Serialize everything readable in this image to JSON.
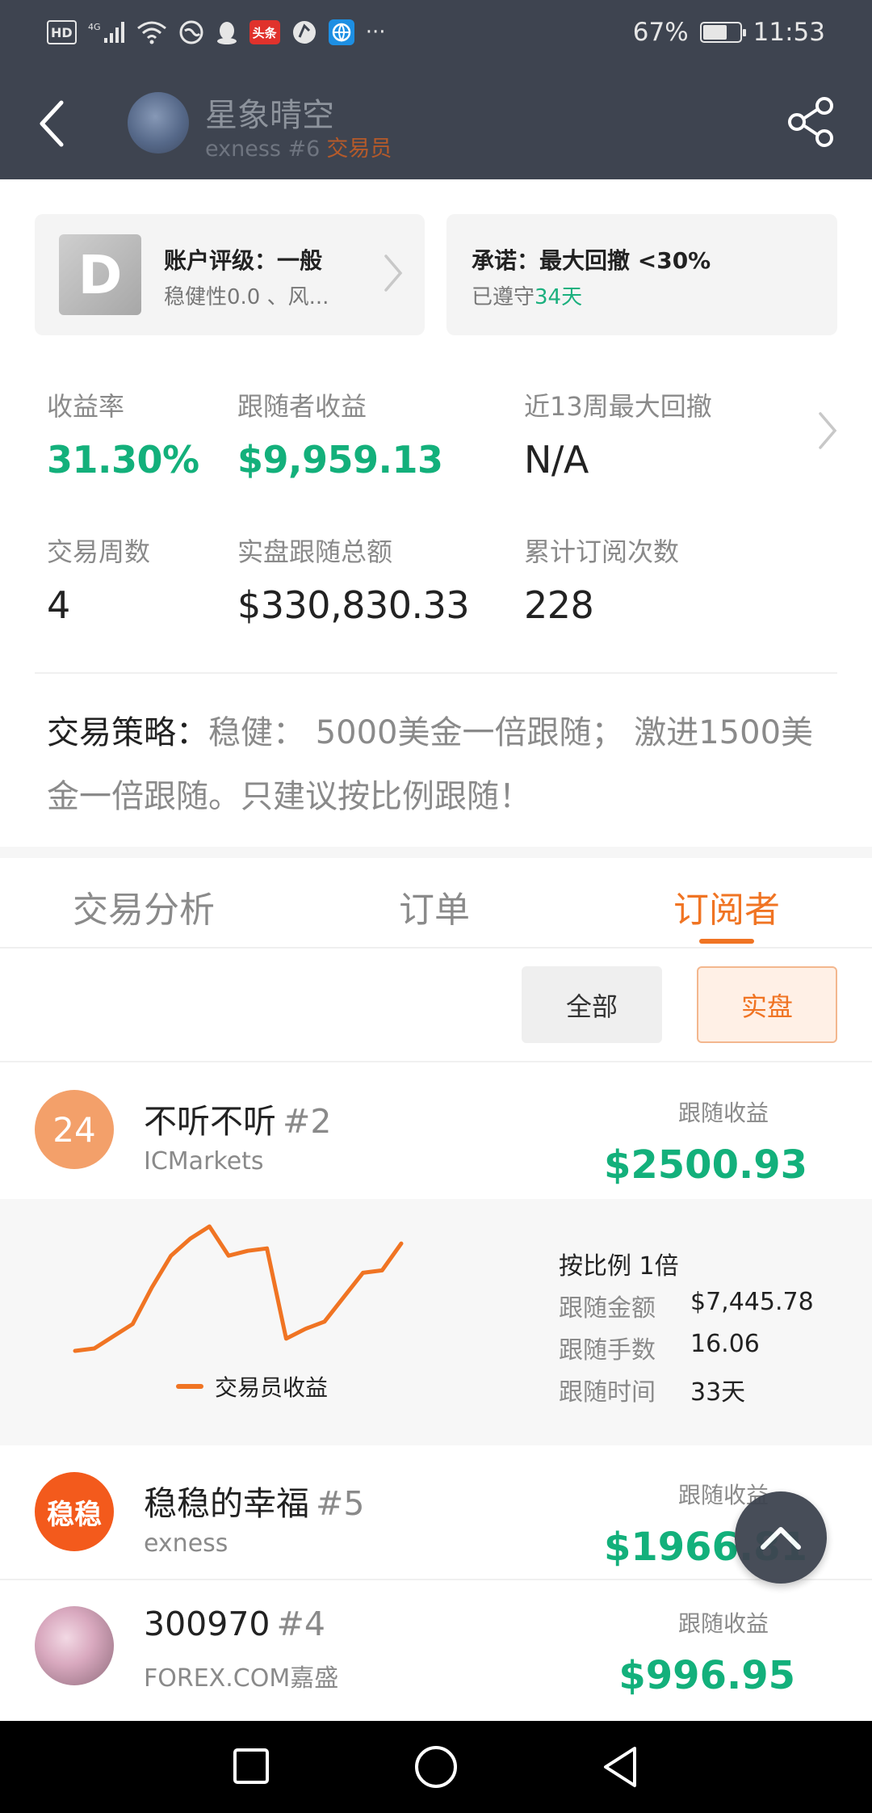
{
  "status_bar": {
    "left_icons": [
      "hd-icon",
      "signal-4g-icon",
      "wifi-icon",
      "vpn-icon",
      "qq-icon",
      "toutiao-icon",
      "app-icon",
      "browser-icon",
      "more-icon"
    ],
    "toutiao_label": "头条",
    "more_label": "···",
    "battery_text": "67%",
    "battery_level": 0.67,
    "time": "11:53"
  },
  "header": {
    "name": "星象晴空",
    "subtitle": "exness #6",
    "role": "交易员"
  },
  "rating_card": {
    "grade": "D",
    "title": "账户评级：一般",
    "subtitle": "稳健性0.0 、风..."
  },
  "promise_card": {
    "title": "承诺：最大回撤 <30%",
    "kept_prefix": "已遵守",
    "kept_days": "34天"
  },
  "stats": [
    {
      "label": "收益率",
      "value": "31.30%"
    },
    {
      "label": "跟随者收益",
      "value": "$9,959.13"
    },
    {
      "label": "近13周最大回撤",
      "value": "N/A"
    },
    {
      "label": "交易周数",
      "value": "4"
    },
    {
      "label": "实盘跟随总额",
      "value": "$330,830.33"
    },
    {
      "label": "累计订阅次数",
      "value": "228"
    }
  ],
  "strategy": {
    "label": "交易策略：",
    "text": "稳健： 5000美金一倍跟随； 激进1500美金一倍跟随。只建议按比例跟随！"
  },
  "tabs": [
    {
      "label": "交易分析",
      "active": false
    },
    {
      "label": "订单",
      "active": false
    },
    {
      "label": "订阅者",
      "active": true
    }
  ],
  "filters": {
    "all": "全部",
    "real": "实盘",
    "selected": "实盘"
  },
  "subscribers": [
    {
      "avatar_text": "24",
      "avatar_color": "#f3a06a",
      "name": "不听不听",
      "num": "#2",
      "broker": "ICMarkets",
      "profit_label": "跟随收益",
      "profit": "$2500.93"
    },
    {
      "avatar_text": "稳稳",
      "avatar_color": "#f35a1c",
      "name": "稳稳的幸福",
      "num": "#5",
      "broker": "exness",
      "profit_label": "跟随收益",
      "profit": "$1966.81"
    },
    {
      "avatar_text": "",
      "avatar_color": "#c9a6b8",
      "name": "300970",
      "num": "#4",
      "broker": "FOREX.COM嘉盛",
      "profit_label": "跟随收益",
      "profit": "$996.95"
    }
  ],
  "detail": {
    "ratio": "按比例 1倍",
    "rows": [
      {
        "label": "跟随金额",
        "value": "$7,445.78"
      },
      {
        "label": "跟随手数",
        "value": "16.06"
      },
      {
        "label": "跟随时间",
        "value": "33天"
      }
    ],
    "legend": "交易员收益"
  },
  "chart_data": {
    "type": "line",
    "series": [
      {
        "name": "交易员收益",
        "values": [
          0,
          0.1,
          0.6,
          1.1,
          2.6,
          3.9,
          4.6,
          5.1,
          3.9,
          4.1,
          4.2,
          0.5,
          0.9,
          1.2,
          2.2,
          3.2,
          3.3,
          4.4
        ]
      }
    ],
    "color": "#f07423"
  },
  "colors": {
    "accent": "#f07423",
    "green": "#13b07b",
    "header": "#3e4450"
  }
}
